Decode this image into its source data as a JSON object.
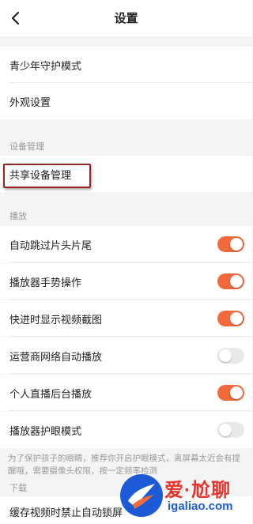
{
  "nav": {
    "title": "设置"
  },
  "top_items": [
    {
      "label": "青少年守护模式"
    },
    {
      "label": "外观设置"
    }
  ],
  "device_section": {
    "header": "设备管理",
    "item_label": "共享设备管理"
  },
  "playback_section": {
    "header": "播放",
    "items": [
      {
        "label": "自动跳过片头片尾",
        "on": true
      },
      {
        "label": "播放器手势操作",
        "on": true
      },
      {
        "label": "快进时显示视频截图",
        "on": true
      },
      {
        "label": "运营商网络自动播放",
        "on": false
      },
      {
        "label": "个人直播后台播放",
        "on": true
      },
      {
        "label": "播放器护眼模式",
        "on": false
      }
    ],
    "note": "为了保护孩子的眼睛，推荐你开启护眼模式，离屏幕太近会有提醒哦，需要摄像头权限，按一定频率检测"
  },
  "download_section": {
    "header": "下载",
    "item_label": "缓存视频时禁止自动锁屏"
  },
  "watermark": {
    "brand": "爱·尬聊",
    "url": "igaliao.com"
  },
  "colors": {
    "accent": "#f26a3c",
    "highlight_border": "#9a2222"
  }
}
